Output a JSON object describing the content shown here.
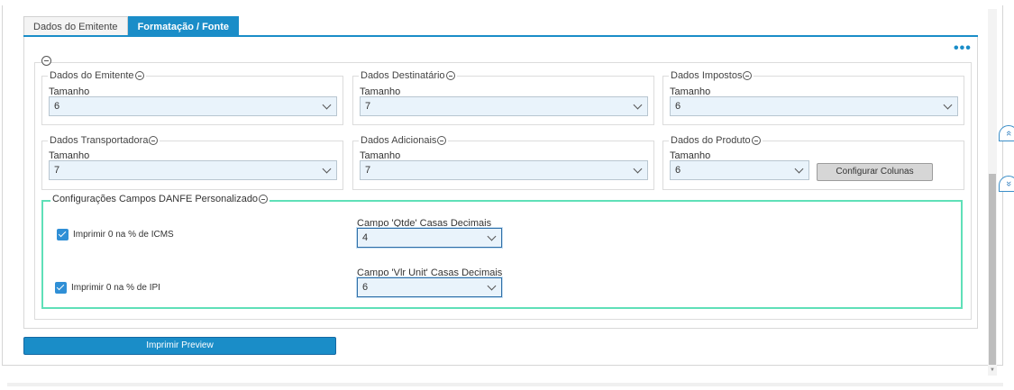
{
  "tabs": [
    {
      "label": "Dados do Emitente",
      "active": false
    },
    {
      "label": "Formatação / Fonte",
      "active": true
    }
  ],
  "more_menu_label": "•••",
  "groups": {
    "emitente": {
      "legend": "Dados do Emitente",
      "label": "Tamanho",
      "value": "6"
    },
    "destinatario": {
      "legend": "Dados Destinatário",
      "label": "Tamanho",
      "value": "7"
    },
    "impostos": {
      "legend": "Dados Impostos",
      "label": "Tamanho",
      "value": "6"
    },
    "transportadora": {
      "legend": "Dados Transportadora",
      "label": "Tamanho",
      "value": "7"
    },
    "adicionais": {
      "legend": "Dados Adicionais",
      "label": "Tamanho",
      "value": "7"
    },
    "produto": {
      "legend": "Dados do Produto",
      "label": "Tamanho",
      "value": "6",
      "button_label": "Configurar Colunas"
    }
  },
  "danfe": {
    "legend": "Configurações Campos DANFE Personalizado",
    "check_icms": {
      "label": "Imprimir 0 na % de ICMS",
      "checked": true
    },
    "check_ipi": {
      "label": "Imprimir 0 na % de IPI",
      "checked": true
    },
    "qtde": {
      "label": "Campo 'Qtde' Casas Decimais",
      "value": "4"
    },
    "vlr_unit": {
      "label": "Campo 'Vlr Unit' Casas Decimais",
      "value": "6"
    }
  },
  "preview_button_label": "Imprimir Preview",
  "side_nav": {
    "up_icon": "double-chevron-up-icon",
    "down_icon": "double-chevron-down-icon"
  },
  "colors": {
    "accent": "#1a8dc8",
    "highlight_border": "#5fe0b8",
    "select_bg": "#e9f3fb"
  }
}
